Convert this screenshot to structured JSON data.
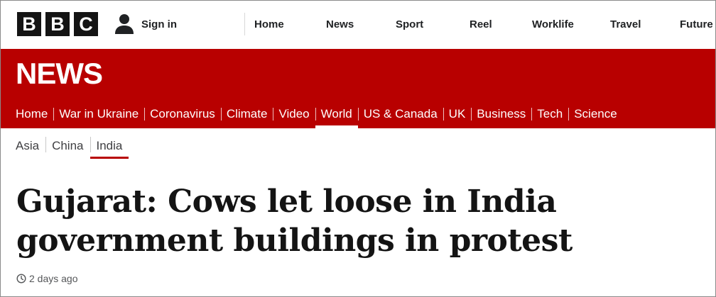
{
  "brand": {
    "logo_letters": [
      "B",
      "B",
      "C"
    ]
  },
  "account": {
    "signin_label": "Sign in",
    "icon": "user-icon"
  },
  "top_nav": {
    "items": [
      {
        "label": "Home"
      },
      {
        "label": "News"
      },
      {
        "label": "Sport"
      },
      {
        "label": "Reel"
      },
      {
        "label": "Worklife"
      },
      {
        "label": "Travel"
      },
      {
        "label": "Future"
      }
    ]
  },
  "news_bar": {
    "title": "NEWS",
    "color": "#b80000",
    "sections": [
      {
        "label": "Home"
      },
      {
        "label": "War in Ukraine"
      },
      {
        "label": "Coronavirus"
      },
      {
        "label": "Climate"
      },
      {
        "label": "Video"
      },
      {
        "label": "World",
        "active": true
      },
      {
        "label": "US & Canada"
      },
      {
        "label": "UK"
      },
      {
        "label": "Business"
      },
      {
        "label": "Tech"
      },
      {
        "label": "Science"
      }
    ]
  },
  "sub_nav": {
    "items": [
      {
        "label": "Asia"
      },
      {
        "label": "China"
      },
      {
        "label": "India",
        "active": true
      }
    ]
  },
  "article": {
    "headline_line1": "Gujarat: Cows let loose in India",
    "headline_line2": "government buildings in protest",
    "timestamp": "2 days ago",
    "timestamp_icon": "clock-icon"
  }
}
